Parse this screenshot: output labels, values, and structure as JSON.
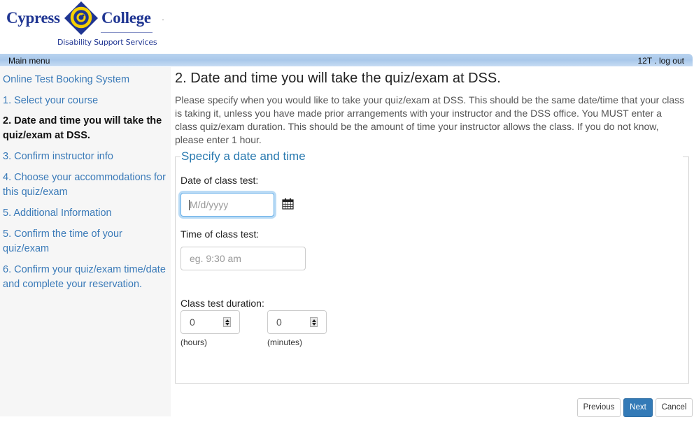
{
  "header": {
    "logo": {
      "word_left": "Cypress",
      "word_right": "College",
      "subtitle": "Disability Support Services",
      "brand_color": "#1f3592",
      "emblem_accent": "#f5d000"
    }
  },
  "menubar": {
    "main_menu": "Main menu",
    "user_text": "12T . log out"
  },
  "sidebar": {
    "items": [
      {
        "label": "Online Test Booking System",
        "active": false
      },
      {
        "label": "1. Select your course",
        "active": false
      },
      {
        "label": "2. Date and time you will take the quiz/exam at DSS.",
        "active": true
      },
      {
        "label": "3. Confirm instructor info",
        "active": false
      },
      {
        "label": "4. Choose your accommodations for this quiz/exam",
        "active": false
      },
      {
        "label": "5. Additional Information",
        "active": false
      },
      {
        "label": "5. Confirm the time of your quiz/exam",
        "active": false
      },
      {
        "label": "6. Confirm your quiz/exam time/date and complete your reservation.",
        "active": false
      }
    ]
  },
  "main": {
    "title": "2. Date and time you will take the quiz/exam at DSS.",
    "intro": "Please specify when you would like to take your quiz/exam at DSS. This should be the same date/time that your class is taking it, unless you have made prior arrangements with your instructor and the DSS office. You MUST enter a class quiz/exam duration. This should be the amount of time your instructor allows the class. If you do not know, please enter 1 hour.",
    "fieldset": {
      "legend": "Specify a date and time",
      "date": {
        "label": "Date of class test:",
        "value": "",
        "placeholder": "M/d/yyyy",
        "icon": "calendar-icon"
      },
      "time": {
        "label": "Time of class test:",
        "value": "",
        "placeholder": "eg. 9:30 am"
      },
      "duration": {
        "label": "Class test duration:",
        "hours": {
          "value": "0",
          "unit": "(hours)"
        },
        "minutes": {
          "value": "0",
          "unit": "(minutes)"
        }
      }
    },
    "buttons": {
      "previous": "Previous",
      "next": "Next",
      "cancel": "Cancel"
    }
  }
}
